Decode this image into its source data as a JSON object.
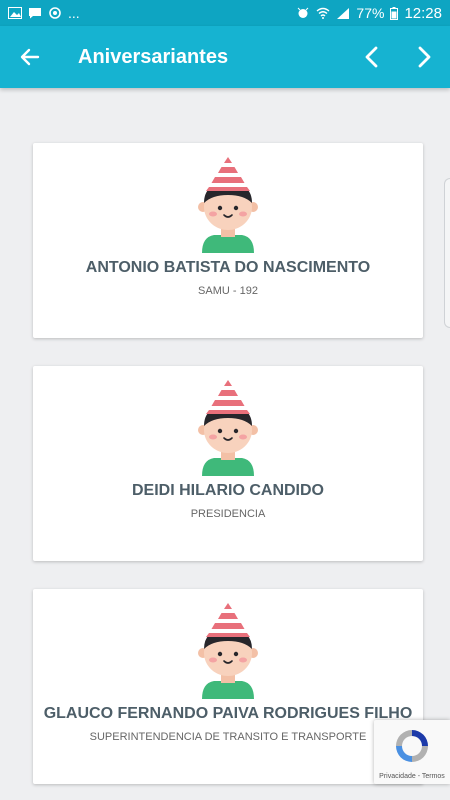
{
  "statusbar": {
    "overflow": "...",
    "battery": "77%",
    "time": "12:28"
  },
  "appbar": {
    "title": "Aniversariantes"
  },
  "birthdays": [
    {
      "name": "ANTONIO BATISTA DO NASCIMENTO",
      "department": "SAMU - 192"
    },
    {
      "name": "DEIDI HILARIO CANDIDO",
      "department": "PRESIDENCIA"
    },
    {
      "name": "GLAUCO FERNANDO PAIVA RODRIGUES FILHO",
      "department": "SUPERINTENDENCIA DE TRANSITO E TRANSPORTE"
    }
  ],
  "recaptcha": {
    "privacy": "Privacidade",
    "separator": " - ",
    "terms": "Termos"
  },
  "colors": {
    "statusbar": "#0ea5c2",
    "appbar": "#16b3d1",
    "background": "#eeeff1",
    "name_text": "#4d5e68",
    "hat_red": "#e8707b",
    "shirt_green": "#3fb97a"
  },
  "icons": {
    "back": "arrow-left-icon",
    "prev": "chevron-left-icon",
    "next": "chevron-right-icon",
    "avatar": "party-boy-avatar-icon"
  }
}
